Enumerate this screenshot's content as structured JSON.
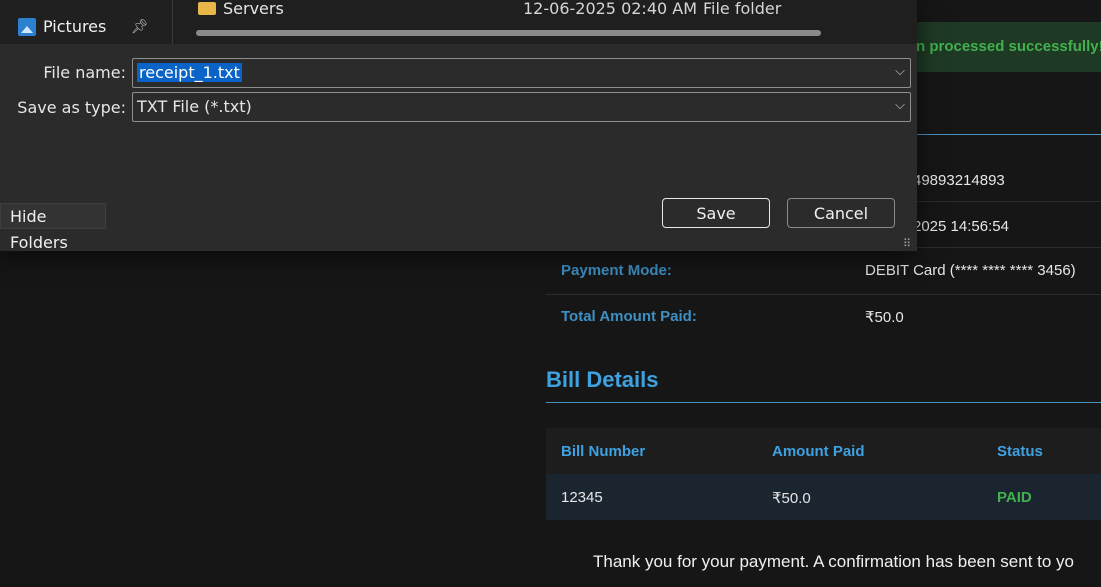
{
  "dialog": {
    "nav_item": {
      "label": "Pictures",
      "icon": "pictures-icon",
      "pin": "pin-icon"
    },
    "folder_row": {
      "name": "Servers",
      "date": "12-06-2025 02:40 AM",
      "type": "File folder"
    },
    "file_name": {
      "label": "File name:",
      "value": "receipt_1.txt"
    },
    "save_type": {
      "label": "Save as type:",
      "value": "TXT File (*.txt)"
    },
    "hide_folders": "Hide Folders",
    "save": "Save",
    "cancel": "Cancel"
  },
  "page": {
    "banner": "n processed successfully!",
    "partial_txn_id": "49893214893",
    "partial_date": "2025 14:56:54",
    "payment": [
      {
        "label": "Payment Mode:",
        "value": "DEBIT Card (**** **** **** 3456)"
      },
      {
        "label": "Total Amount Paid:",
        "value": "₹50.0"
      }
    ],
    "bill_details_title": "Bill Details",
    "bill_headers": [
      "Bill Number",
      "Amount Paid",
      "Status"
    ],
    "bill_rows": [
      [
        "12345",
        "₹50.0",
        "PAID"
      ]
    ],
    "thanks": "Thank you for your payment. A confirmation has been sent to yo"
  },
  "colors": {
    "accent": "#3ea1e0",
    "label_blue": "#3d8fc4",
    "success": "#43b04f",
    "selection": "#0a64c8"
  }
}
